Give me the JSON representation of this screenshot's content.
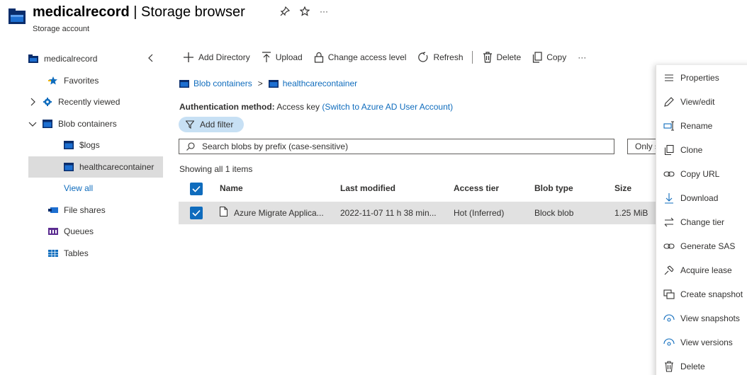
{
  "header": {
    "title_bold": "medicalrecord",
    "title_rest": " | Storage browser",
    "subtitle": "Storage account",
    "more": "···"
  },
  "sidebar": {
    "items": [
      {
        "label": "medicalrecord"
      },
      {
        "label": "Favorites"
      },
      {
        "label": "Recently viewed"
      },
      {
        "label": "Blob containers"
      },
      {
        "label": "$logs"
      },
      {
        "label": "healthcarecontainer"
      },
      {
        "label": "View all"
      },
      {
        "label": "File shares"
      },
      {
        "label": "Queues"
      },
      {
        "label": "Tables"
      }
    ]
  },
  "toolbar": {
    "add_directory": "Add Directory",
    "upload": "Upload",
    "change_access": "Change access level",
    "refresh": "Refresh",
    "delete": "Delete",
    "copy": "Copy",
    "more": "···"
  },
  "breadcrumb": {
    "root": "Blob containers",
    "sep": ">",
    "current": "healthcarecontainer"
  },
  "auth": {
    "label": "Authentication method:",
    "value": "Access key",
    "switch_link": "(Switch to Azure AD User Account)"
  },
  "filter": {
    "label": "Add filter"
  },
  "search": {
    "placeholder": "Search blobs by prefix (case-sensitive)"
  },
  "only_toggle": "Only s",
  "showing": "Showing all 1 items",
  "table": {
    "columns": [
      "Name",
      "Last modified",
      "Access tier",
      "Blob type",
      "Size"
    ],
    "rows": [
      {
        "name": "Azure Migrate Applica...",
        "modified": "2022-11-07 11 h 38 min...",
        "tier": "Hot (Inferred)",
        "type": "Block blob",
        "size": "1.25 MiB"
      }
    ]
  },
  "context_menu": {
    "items": [
      {
        "label": "Properties",
        "icon": "list-icon"
      },
      {
        "label": "View/edit",
        "icon": "pencil-icon"
      },
      {
        "label": "Rename",
        "icon": "rename-icon"
      },
      {
        "label": "Clone",
        "icon": "clone-icon"
      },
      {
        "label": "Copy URL",
        "icon": "link-icon"
      },
      {
        "label": "Download",
        "icon": "download-icon"
      },
      {
        "label": "Change tier",
        "icon": "swap-icon"
      },
      {
        "label": "Generate SAS",
        "icon": "link-icon"
      },
      {
        "label": "Acquire lease",
        "icon": "lease-icon"
      },
      {
        "label": "Create snapshot",
        "icon": "snapshot-icon"
      },
      {
        "label": "View snapshots",
        "icon": "eye-icon"
      },
      {
        "label": "View versions",
        "icon": "eye-icon"
      },
      {
        "label": "Delete",
        "icon": "trash-icon"
      }
    ]
  },
  "colors": {
    "accent": "#0f6cbd",
    "selected_row": "#e1e1e1",
    "filter_pill": "#c7e0f4"
  }
}
